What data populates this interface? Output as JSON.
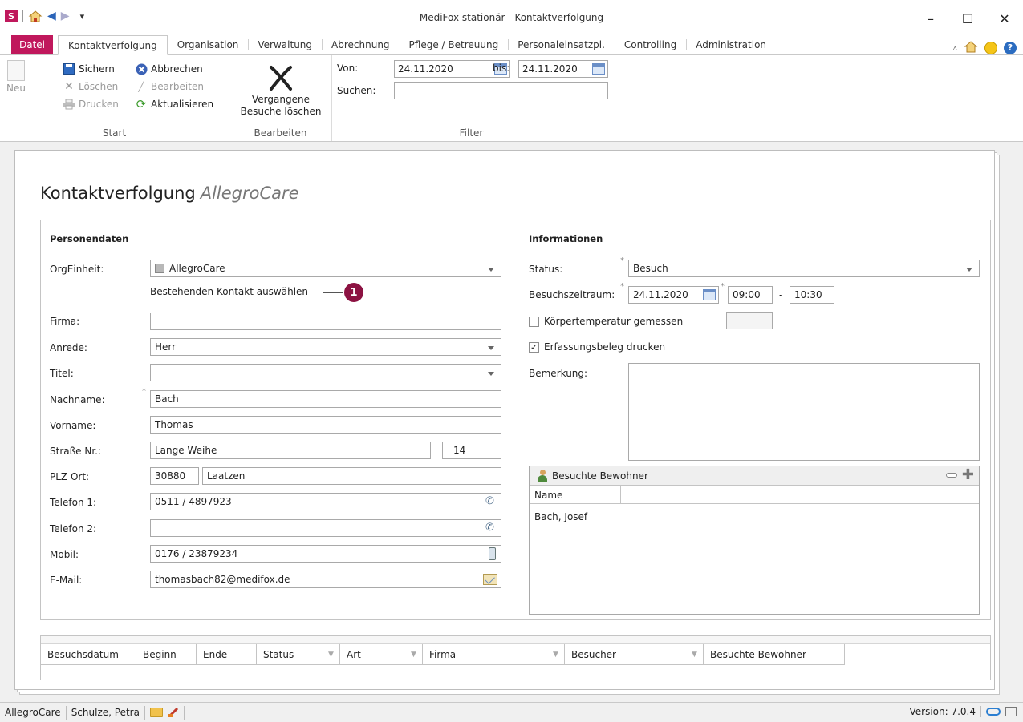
{
  "window": {
    "title": "MediFox stationär - Kontaktverfolgung",
    "app_logo": "S",
    "minimize": "–",
    "maximize": "☐",
    "close": "✕"
  },
  "tabs": {
    "file": "Datei",
    "items": [
      "Kontaktverfolgung",
      "Organisation",
      "Verwaltung",
      "Abrechnung",
      "Pflege / Betreuung",
      "Personaleinsatzpl.",
      "Controlling",
      "Administration"
    ],
    "active": "Kontaktverfolgung"
  },
  "ribbon": {
    "start": {
      "label": "Start",
      "neu": "Neu",
      "sichern": "Sichern",
      "abbrechen": "Abbrechen",
      "loeschen": "Löschen",
      "bearbeiten": "Bearbeiten",
      "drucken": "Drucken",
      "aktualisieren": "Aktualisieren"
    },
    "bearbeiten": {
      "label": "Bearbeiten",
      "button_line1": "Vergangene",
      "button_line2": "Besuche löschen"
    },
    "filter": {
      "label": "Filter",
      "von_label": "Von:",
      "von_value": "24.11.2020",
      "bis_label": "bis:",
      "bis_value": "24.11.2020",
      "suchen_label": "Suchen:",
      "suchen_value": ""
    }
  },
  "document": {
    "title": "Kontaktverfolgung",
    "subtitle": "AllegroCare"
  },
  "personendaten": {
    "heading": "Personendaten",
    "orgeinheit_label": "OrgEinheit:",
    "orgeinheit_value": "AllegroCare",
    "contact_link": "Bestehenden Kontakt auswählen",
    "callout": "1",
    "firma_label": "Firma:",
    "firma_value": "",
    "anrede_label": "Anrede:",
    "anrede_value": "Herr",
    "titel_label": "Titel:",
    "titel_value": "",
    "nachname_label": "Nachname:",
    "nachname_value": "Bach",
    "vorname_label": "Vorname:",
    "vorname_value": "Thomas",
    "strasse_label": "Straße Nr.:",
    "strasse_value": "Lange Weihe",
    "hausnr_value": "14",
    "plzort_label": "PLZ Ort:",
    "plz_value": "30880",
    "ort_value": "Laatzen",
    "telefon1_label": "Telefon 1:",
    "telefon1_value": "0511 / 4897923",
    "telefon2_label": "Telefon 2:",
    "telefon2_value": "",
    "mobil_label": "Mobil:",
    "mobil_value": "0176 / 23879234",
    "email_label": "E-Mail:",
    "email_value": "thomasbach82@medifox.de"
  },
  "informationen": {
    "heading": "Informationen",
    "status_label": "Status:",
    "status_value": "Besuch",
    "zeitraum_label": "Besuchszeitraum:",
    "datum_value": "24.11.2020",
    "von_zeit": "09:00",
    "dash": "-",
    "bis_zeit": "10:30",
    "koerpertemp_label": "Körpertemperatur gemessen",
    "koerpertemp_checked": false,
    "koerpertemp_value": "",
    "erfassungsbeleg_label": "Erfassungsbeleg drucken",
    "erfassungsbeleg_checked": true,
    "bemerkung_label": "Bemerkung:",
    "bemerkung_value": "",
    "bewohner": {
      "heading": "Besuchte Bewohner",
      "column": "Name",
      "rows": [
        "Bach, Josef"
      ]
    }
  },
  "grid": {
    "columns": [
      "Besuchsdatum",
      "Beginn",
      "Ende",
      "Status",
      "Art",
      "Firma",
      "Besucher",
      "Besuchte Bewohner"
    ]
  },
  "statusbar": {
    "orgeinheit": "AllegroCare",
    "user": "Schulze, Petra",
    "version": "Version: 7.0.4"
  }
}
